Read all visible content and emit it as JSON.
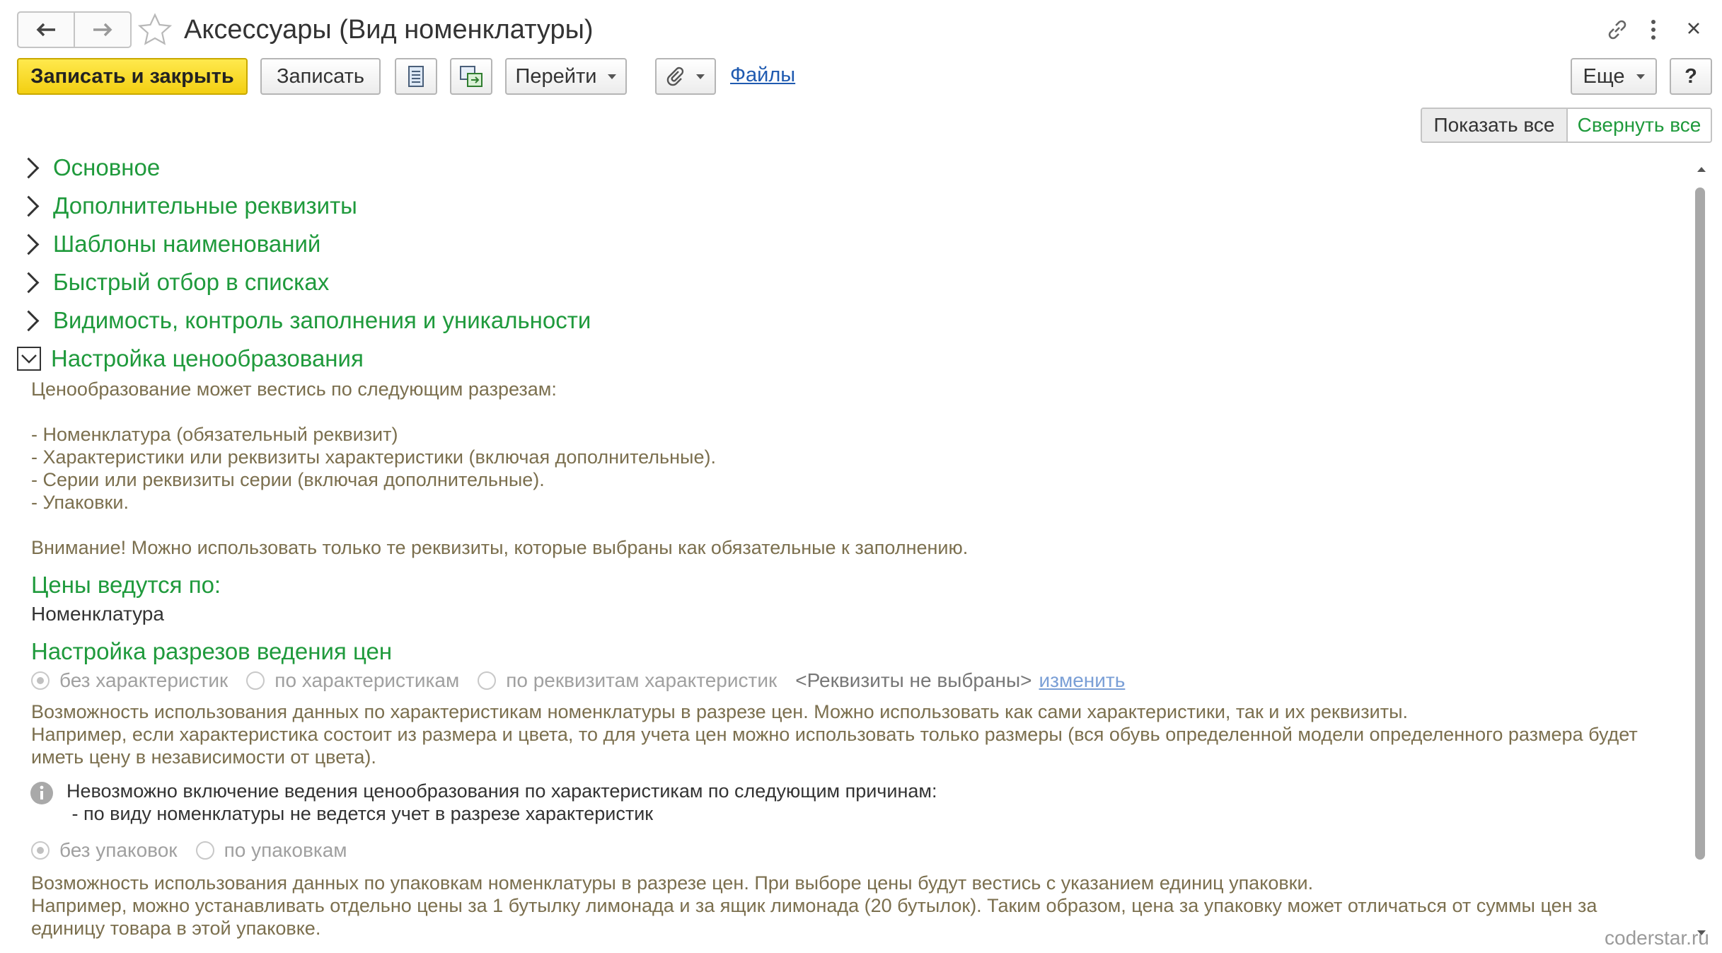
{
  "window": {
    "title": "Аксессуары (Вид номенклатуры)"
  },
  "toolbar": {
    "save_close": "Записать и закрыть",
    "save": "Записать",
    "goto": "Перейти",
    "files": "Файлы",
    "more": "Еще",
    "help": "?"
  },
  "panel": {
    "show_all": "Показать все",
    "collapse_all": "Свернуть все"
  },
  "sections": [
    "Основное",
    "Дополнительные реквизиты",
    "Шаблоны наименований",
    "Быстрый отбор в списках",
    "Видимость, контроль заполнения и уникальности",
    "Настройка ценообразования"
  ],
  "pricing": {
    "intro": [
      "Ценообразование может вестись по следующим разрезам:",
      "- Номенклатура (обязательный реквизит)",
      "- Характеристики или реквизиты характеристики (включая дополнительные).",
      "- Серии или реквизиты серии (включая дополнительные).",
      "- Упаковки.",
      "Внимание! Можно использовать только те реквизиты, которые выбраны как обязательные к заполнению."
    ],
    "prices_by_label": "Цены ведутся по:",
    "prices_by_value": "Номенклатура",
    "cuts_heading": "Настройка разрезов ведения цен",
    "char_options": [
      "без характеристик",
      "по характеристикам",
      "по реквизитам характеристик"
    ],
    "char_selected": 0,
    "requisites_not_selected": "<Реквизиты не выбраны>",
    "change_link": "изменить",
    "char_desc": [
      "Возможность использования данных по характеристикам номенклатуры в разрезе цен. Можно использовать как сами характеристики, так и их реквизиты.",
      "Например, если характеристика состоит из размера и цвета, то для учета цен можно использовать только размеры (вся обувь определенной модели определенного размера будет",
      "иметь цену в независимости от цвета)."
    ],
    "info_lines": [
      "Невозможно включение ведения ценообразования по характеристикам по следующим причинам:",
      " - по виду номенклатуры не ведется учет в разрезе характеристик"
    ],
    "pack_options": [
      "без упаковок",
      "по упаковкам"
    ],
    "pack_selected": 0,
    "pack_desc": [
      "Возможность использования данных по упаковкам номенклатуры в разрезе цен. При выборе цены будут вестись с указанием единиц упаковки.",
      "Например, можно устанавливать отдельно цены за 1 бутылку лимонада и за ящик лимонада (20 бутылок). Таким образом, цена за упаковку может отличаться от суммы цен за",
      "единицу товара в этой упаковке."
    ]
  },
  "watermark": "coderstar.ru"
}
